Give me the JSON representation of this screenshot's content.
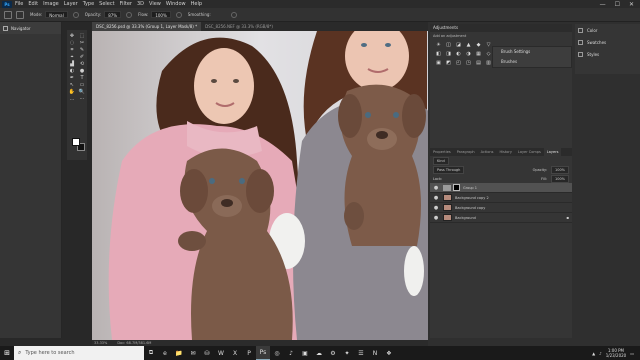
{
  "menubar": {
    "logo": "Ps",
    "items": [
      "File",
      "Edit",
      "Image",
      "Layer",
      "Type",
      "Select",
      "Filter",
      "3D",
      "View",
      "Window",
      "Help"
    ],
    "window_buttons": [
      "—",
      "☐",
      "✕"
    ]
  },
  "options": {
    "mode_label": "Mode:",
    "mode_value": "Normal",
    "opacity_label": "Opacity:",
    "opacity_value": "87%",
    "flow_label": "Flow:",
    "flow_value": "100%",
    "smoothing_label": "Smoothing:"
  },
  "tabs": [
    {
      "label": "DSC_8256.psd @ 33.3% (Group 1, Layer Mask/8) *",
      "active": true
    },
    {
      "label": "DSC_8256.NEF @ 33.3% (RGB/8*)",
      "active": false
    }
  ],
  "navigator": {
    "label": "Navigator"
  },
  "tools": [
    "✥",
    "⬚",
    "◌",
    "✂",
    "⌗",
    "✎",
    "⌖",
    "✐",
    "▟",
    "⟲",
    "◐",
    "●",
    "✒",
    "T",
    "↖",
    "▭",
    "✋",
    "🔍",
    "…",
    "⋯"
  ],
  "canvas": {
    "colors": {
      "bg": "#d8d8dc",
      "coat_pink": "#e6aab8",
      "coat_grey": "#8c8890",
      "puppy": "#7b5a48",
      "hair": "#4a2a1c",
      "skin": "#edc7b3"
    }
  },
  "status": {
    "zoom": "33.33%",
    "doc": "Doc: 68.7M/381.6M"
  },
  "adjustments": {
    "title": "Adjustments",
    "subtitle": "Add an adjustment",
    "icons": [
      "☀",
      "◫",
      "◪",
      "▲",
      "◆",
      "▽",
      "◧",
      "◨",
      "◐",
      "◑",
      "▦",
      "◇",
      "▣",
      "◩",
      "◰",
      "◳",
      "▤",
      "▥"
    ]
  },
  "brush_panel": {
    "items": [
      "Brush Settings",
      "Brushes"
    ]
  },
  "libraries": {
    "items": [
      "Color",
      "Swatches",
      "Styles"
    ]
  },
  "layers": {
    "tabs": [
      "Properties",
      "Paragraph",
      "Actions",
      "History",
      "Layer Comps",
      "Layers"
    ],
    "active_tab": "Layers",
    "kind_label": "Kind",
    "blend_mode": "Pass Through",
    "opacity_label": "Opacity:",
    "opacity_value": "100%",
    "lock_label": "Lock:",
    "fill_label": "Fill:",
    "fill_value": "100%",
    "rows": [
      {
        "name": "Group 1",
        "type": "group",
        "selected": true
      },
      {
        "name": "Background copy 2",
        "type": "layer",
        "selected": false
      },
      {
        "name": "Background copy",
        "type": "layer",
        "selected": false
      },
      {
        "name": "Background",
        "type": "layer",
        "selected": false
      }
    ]
  },
  "taskbar": {
    "search_placeholder": "Type here to search",
    "apps": [
      "⧉",
      "e",
      "📁",
      "✉",
      "⛁",
      "W",
      "X",
      "P",
      "Ps",
      "◎",
      "♪",
      "▣",
      "☁",
      "⚙",
      "✦",
      "☰",
      "N",
      "❖"
    ],
    "time": "1:00 PM",
    "date": "1/23/2020"
  }
}
